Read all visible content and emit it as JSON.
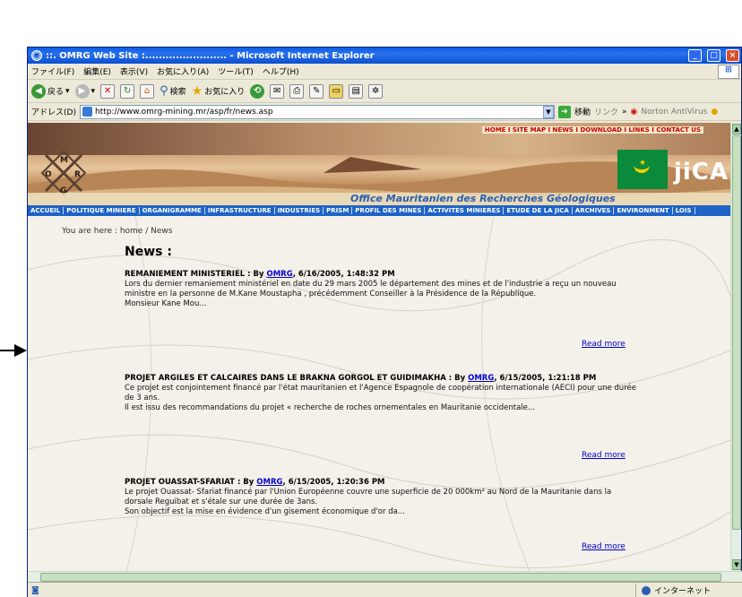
{
  "window": {
    "title": "::. OMRG Web Site :........................ - Microsoft Internet Explorer"
  },
  "menu": [
    "ファイル(F)",
    "編集(E)",
    "表示(V)",
    "お気に入り(A)",
    "ツール(T)",
    "ヘルプ(H)"
  ],
  "toolbar": {
    "back": "戻る",
    "search": "検索",
    "favorites": "お気に入り"
  },
  "address": {
    "label": "アドレス(D)",
    "url": "http://www.omrg-mining.mr/asp/fr/news.asp",
    "go": "移動",
    "links": "リンク",
    "antivirus": "Norton AntiVirus"
  },
  "site": {
    "toplinks": "HOME I SITE MAP I NEWS I DOWNLOAD I LINKS I CONTACT US",
    "banner_title": "Office Mauritanien des Recherches Géologiques",
    "logo_letters": [
      "M",
      "O",
      "R",
      "G"
    ],
    "jica": "jiCA",
    "nav": [
      "ACCUEIL",
      "POLITIQUE MINIERE",
      "ORGANIGRAMME",
      "INFRASTRUCTURE",
      "INDUSTRIES",
      "PRISM",
      "PROFIL DES MINES",
      "ACTIVITES MINIERES",
      "ETUDE DE LA JICA",
      "ARCHIVES",
      "ENVIRONMENT",
      "LOIS"
    ]
  },
  "page": {
    "breadcrumb": "You are here : home / News",
    "heading": "News :",
    "read_more": "Read more",
    "news": [
      {
        "title": "REMANIEMENT MINISTERIEL : By ",
        "author": "OMRG",
        "date": ", 6/16/2005, 1:48:32 PM",
        "body": "Lors du dernier remaniement ministériel en date du 29 mars 2005 le département des mines et de l'industrie a reçu un nouveau ministre en la personne de M.Kane Moustapha , précédemment Conseiller à la Présidence de la République.",
        "body2": "Monsieur Kane Mou..."
      },
      {
        "title": "PROJET ARGILES ET CALCAIRES DANS LE BRAKNA GORGOL ET GUIDIMAKHA : By ",
        "author": "OMRG",
        "date": ", 6/15/2005, 1:21:18 PM",
        "body": "Ce projet est conjointement financé par l'état mauritanien et l'Agence Espagnole de coopération internationale (AECI) pour une durée de 3 ans.",
        "body2": "Il est issu des recommandations du projet « recherche de roches ornementales en Mauritanie occidentale..."
      },
      {
        "title": "PROJET OUASSAT-SFARIAT : By ",
        "author": "OMRG",
        "date": ", 6/15/2005, 1:20:36 PM",
        "body": "Le projet Ouassat- Sfariat financé par l'Union Européenne couvre une superficie de 20 000km² au Nord de la Mauritanie dans la dorsale Reguibat et s'étale sur une durée de 3ans.",
        "body2": "Son objectif est la mise en évidence d'un gisement économique d'or da..."
      }
    ]
  },
  "status": {
    "zone": "インターネット"
  }
}
